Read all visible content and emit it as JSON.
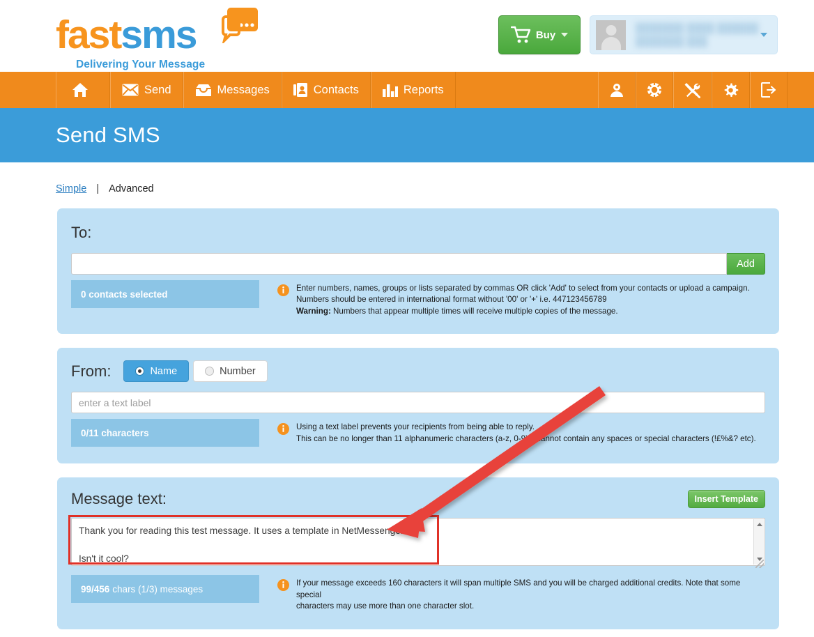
{
  "brand": {
    "name_part1": "fast",
    "name_part2": "sms",
    "tagline": "Delivering Your Message",
    "accent_orange": "#f7941e",
    "accent_blue": "#3a9bd9"
  },
  "header": {
    "buy_label": "Buy",
    "cart_icon": "shopping-cart-icon",
    "buy_caret_icon": "chevron-down-icon",
    "account_name": "",
    "avatar_icon": "user-avatar-icon",
    "account_caret_icon": "chevron-down-icon"
  },
  "nav": {
    "background": "#f08a1c",
    "left_items": [
      {
        "label": "",
        "icon": "home-icon"
      },
      {
        "label": "Send",
        "icon": "envelope-icon"
      },
      {
        "label": "Messages",
        "icon": "inbox-icon"
      },
      {
        "label": "Contacts",
        "icon": "contacts-book-icon"
      },
      {
        "label": "Reports",
        "icon": "bar-chart-icon"
      }
    ],
    "right_items": [
      {
        "label": "",
        "icon": "user-icon"
      },
      {
        "label": "",
        "icon": "lifebuoy-icon"
      },
      {
        "label": "",
        "icon": "tools-icon"
      },
      {
        "label": "",
        "icon": "gear-icon"
      },
      {
        "label": "",
        "icon": "logout-icon"
      }
    ]
  },
  "page": {
    "title": "Send SMS",
    "title_bar_color": "#3b9cd9"
  },
  "tabs": {
    "simple": "Simple",
    "separator": "|",
    "advanced": "Advanced"
  },
  "to_panel": {
    "title": "To:",
    "input_value": "",
    "input_placeholder": "",
    "add_label": "Add",
    "counter": "0 contacts selected",
    "hint_line1": "Enter numbers, names, groups or lists separated by commas OR click 'Add' to select from your contacts or upload a campaign.",
    "hint_line2": "Numbers should be entered in international format without '00' or '+' i.e. 447123456789",
    "hint_warning_label": "Warning:",
    "hint_line3": " Numbers that appear multiple times will receive multiple copies of the message.",
    "info_icon": "info-icon"
  },
  "from_panel": {
    "title": "From:",
    "option_name": "Name",
    "option_number": "Number",
    "selected_option": "Name",
    "input_value": "",
    "input_placeholder": "enter a text label",
    "counter": "0/11 characters",
    "hint_line1": "Using a text label prevents your recipients from being able to reply.",
    "hint_line2": "This can be no longer than 11 alphanumeric characters (a-z, 0-9) it cannot contain any spaces or special characters (!£%&? etc).",
    "info_icon": "info-icon"
  },
  "message_panel": {
    "title": "Message text:",
    "insert_template_label": "Insert Template",
    "message_value": "Thank you for reading this test message. It uses a template in NetMessenger.\n\nIsn't it cool?",
    "counter_bold": "99/456",
    "counter_rest": "chars (1/3) messages",
    "hint_line1": "If your message exceeds 160 characters it will span multiple SMS and you will be charged additional credits. Note that some special",
    "hint_line2": "characters may use more than one character slot.",
    "info_icon": "info-icon",
    "highlight_color": "#e03127"
  },
  "annotation": {
    "arrow_color": "#e8433a",
    "arrow_name": "red-pointer-arrow"
  }
}
